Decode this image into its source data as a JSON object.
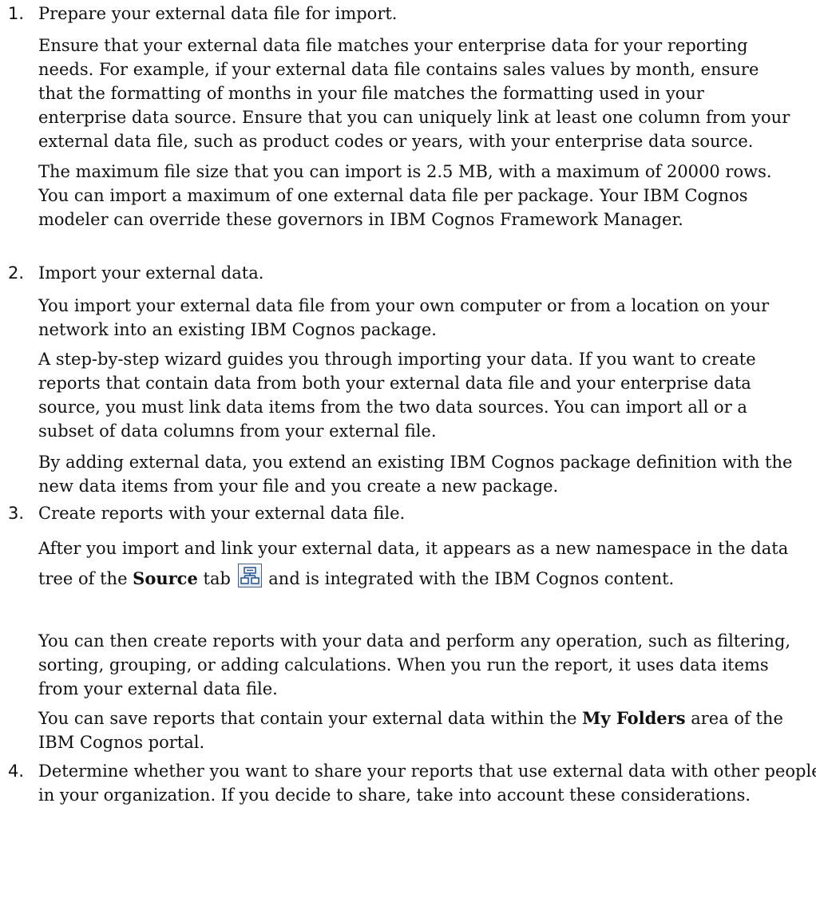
{
  "steps": [
    {
      "number": "1.",
      "heading": "Prepare your external data file for import.",
      "paragraphs": [
        "Ensure that your external data file matches your enterprise data for your reporting needs. For example, if your external data file contains sales values by month, ensure that the formatting of months in your file matches the formatting used in your enterprise data source. Ensure that you can uniquely link at least one column from your external data file, such as product codes or years, with your enterprise data source.",
        "The maximum file size that you can import is 2.5 MB, with a maximum of 20000 rows. You can import a maximum of one external data file per package. Your IBM Cognos modeler can override these governors in IBM Cognos Framework Manager."
      ]
    },
    {
      "number": "2.",
      "heading": "Import your external data.",
      "paragraphs": [
        "You import your external data file from your own computer or from a location on your network into an existing IBM Cognos package.",
        "A step-by-step wizard guides you through importing your data. If you want to create reports that contain data from both your external data file and your enterprise data source, you must link data items from the two data sources. You can import all or a subset of data columns from your external file.",
        "By adding external data, you extend an existing IBM Cognos package definition with the new data items from your file and you create a new package."
      ]
    },
    {
      "number": "3.",
      "heading": "Create reports with your external data file.",
      "p1_before": "After you import and link your external data, it appears as a new namespace in the data tree of the ",
      "p1_bold": "Source",
      "p1_mid": " tab",
      "p1_icon": "source-tab-icon",
      "p1_after": " and is integrated with the IBM Cognos content.",
      "p2": "You can then create reports with your data and perform any operation, such as filtering, sorting, grouping, or adding calculations. When you run the report, it uses data items from your external data file.",
      "p3_before": "You can save reports that contain your external data within the ",
      "p3_bold": "My Folders",
      "p3_after": " area of the IBM Cognos portal."
    },
    {
      "number": "4.",
      "heading": "Determine whether you want to share your reports that use external data with other people in your organization. If you decide to share, take into account these considerations."
    }
  ]
}
